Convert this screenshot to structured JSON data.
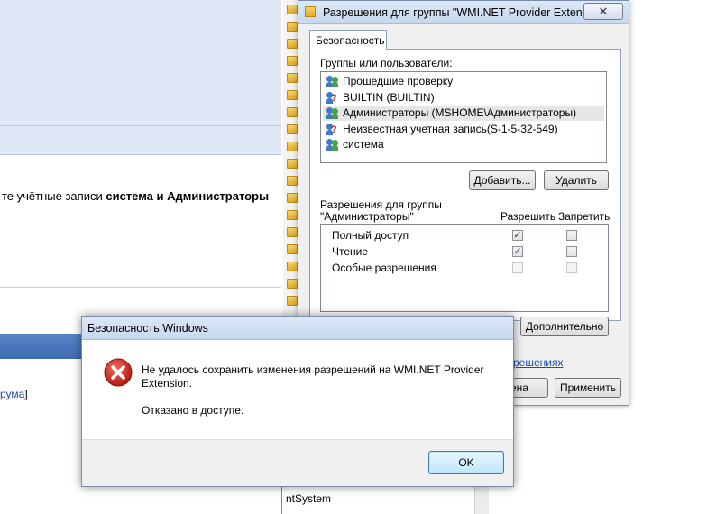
{
  "background": {
    "text_prefix": "те учётные записи ",
    "text_bold": "система и Администраторы",
    "link_text": "рума",
    "link_suffix": "]",
    "list_text": "ntSystem"
  },
  "perm_dialog": {
    "title": "Разрешения для группы \"WMI.NET Provider Extensi",
    "close_glyph": "✕",
    "tab": "Безопасность",
    "groups_label": "Группы или пользователи:",
    "users": [
      {
        "name": "Прошедшие проверку",
        "unknown": false
      },
      {
        "name": "BUILTIN (BUILTIN)",
        "unknown": true
      },
      {
        "name": "Администраторы (MSHOME\\Администраторы)",
        "unknown": false
      },
      {
        "name": "Неизвестная учетная запись(S-1-5-32-549)",
        "unknown": true
      },
      {
        "name": "система",
        "unknown": false
      }
    ],
    "selected_user_index": 2,
    "add_button": "Добавить...",
    "remove_button": "Удалить",
    "permissions_for_line1": "Разрешения для группы",
    "permissions_for_line2": "\"Администраторы\"",
    "allow_header": "Разрешить",
    "deny_header": "Запретить",
    "permissions": [
      {
        "name": "Полный доступ",
        "allow": true,
        "deny": false,
        "disabled": false
      },
      {
        "name": "Чтение",
        "allow": true,
        "deny": false,
        "disabled": false
      },
      {
        "name": "Особые разрешения",
        "allow": false,
        "deny": false,
        "disabled": true
      }
    ],
    "advanced_button": "Дополнительно",
    "link_partial": "решениях",
    "ok_partial": "ена",
    "apply_button": "Применить"
  },
  "error_dialog": {
    "title": "Безопасность Windows",
    "message": "Не удалось сохранить изменения разрешений на WMI.NET Provider Extension.",
    "detail": "Отказано в доступе.",
    "ok_button": "OK"
  }
}
